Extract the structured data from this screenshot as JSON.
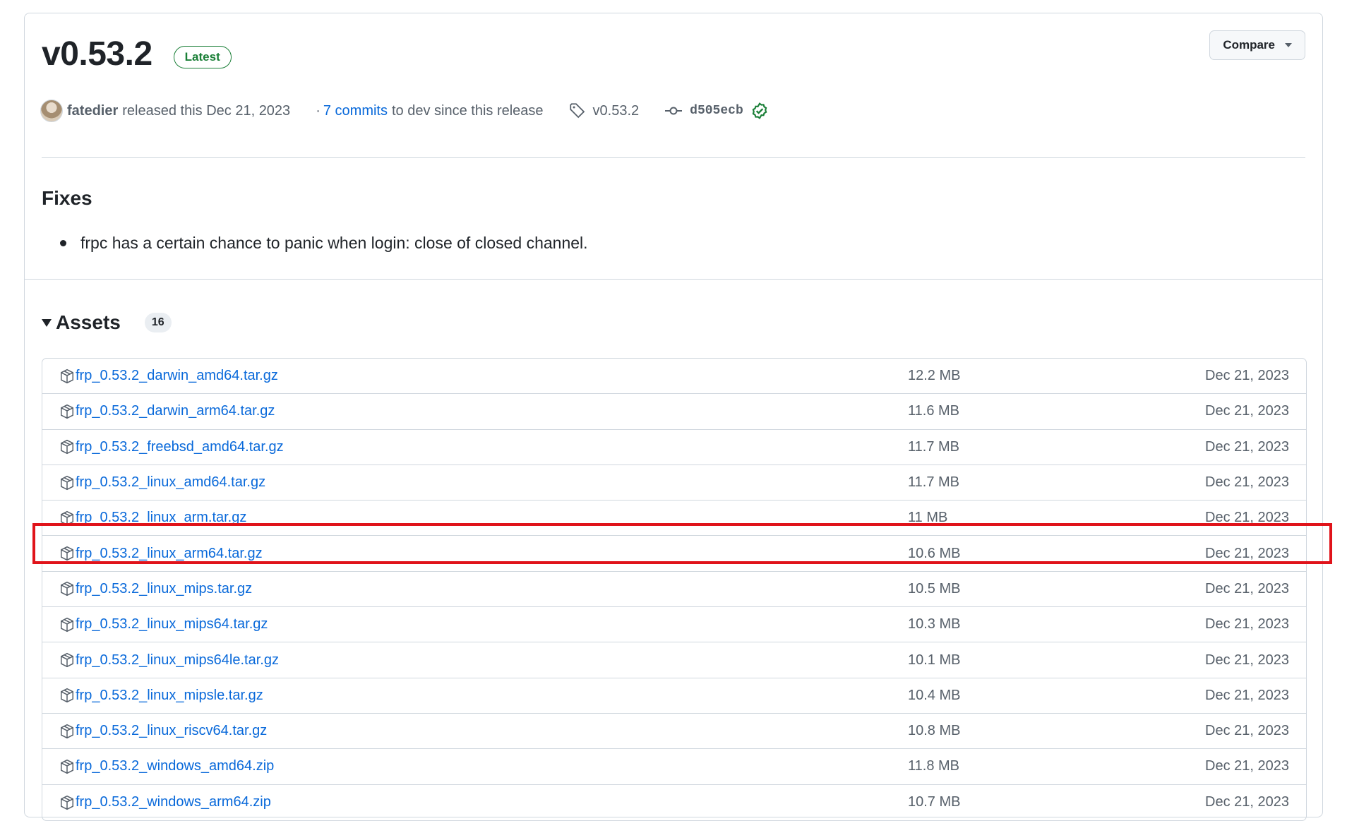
{
  "release": {
    "title": "v0.53.2",
    "badge": "Latest",
    "compare_label": "Compare",
    "author": "fatedier",
    "released_text": "released this Dec 21, 2023",
    "commits_prefix": "·",
    "commits_link": "7 commits",
    "commits_suffix": "to dev since this release",
    "tag": "v0.53.2",
    "commit_sha": "d505ecb"
  },
  "notes": {
    "heading": "Fixes",
    "items": [
      "frpc has a certain chance to panic when login: close of closed channel."
    ]
  },
  "assets": {
    "title": "Assets",
    "count": "16",
    "rows": [
      {
        "name": "frp_0.53.2_darwin_amd64.tar.gz",
        "size": "12.2 MB",
        "date": "Dec 21, 2023"
      },
      {
        "name": "frp_0.53.2_darwin_arm64.tar.gz",
        "size": "11.6 MB",
        "date": "Dec 21, 2023"
      },
      {
        "name": "frp_0.53.2_freebsd_amd64.tar.gz",
        "size": "11.7 MB",
        "date": "Dec 21, 2023"
      },
      {
        "name": "frp_0.53.2_linux_amd64.tar.gz",
        "size": "11.7 MB",
        "date": "Dec 21, 2023"
      },
      {
        "name": "frp_0.53.2_linux_arm.tar.gz",
        "size": "11 MB",
        "date": "Dec 21, 2023"
      },
      {
        "name": "frp_0.53.2_linux_arm64.tar.gz",
        "size": "10.6 MB",
        "date": "Dec 21, 2023"
      },
      {
        "name": "frp_0.53.2_linux_mips.tar.gz",
        "size": "10.5 MB",
        "date": "Dec 21, 2023"
      },
      {
        "name": "frp_0.53.2_linux_mips64.tar.gz",
        "size": "10.3 MB",
        "date": "Dec 21, 2023"
      },
      {
        "name": "frp_0.53.2_linux_mips64le.tar.gz",
        "size": "10.1 MB",
        "date": "Dec 21, 2023"
      },
      {
        "name": "frp_0.53.2_linux_mipsle.tar.gz",
        "size": "10.4 MB",
        "date": "Dec 21, 2023"
      },
      {
        "name": "frp_0.53.2_linux_riscv64.tar.gz",
        "size": "10.8 MB",
        "date": "Dec 21, 2023"
      },
      {
        "name": "frp_0.53.2_windows_amd64.zip",
        "size": "11.8 MB",
        "date": "Dec 21, 2023"
      },
      {
        "name": "frp_0.53.2_windows_arm64.zip",
        "size": "10.7 MB",
        "date": "Dec 21, 2023"
      }
    ]
  },
  "icons": {
    "tag": "tag-icon",
    "commit": "git-commit-icon",
    "verified": "verified-check-icon",
    "package": "package-icon"
  },
  "colors": {
    "link": "#0969da",
    "latest": "#1a7f37",
    "highlight": "#e0131a"
  }
}
